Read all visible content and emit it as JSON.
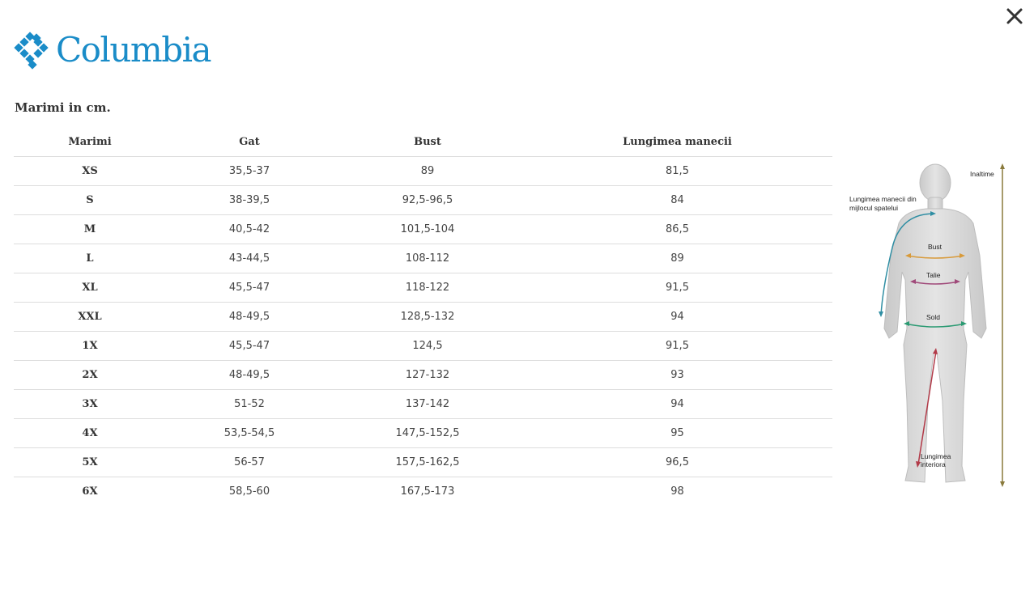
{
  "brand": {
    "name": "Columbia",
    "color": "#1a8cc8"
  },
  "close_icon": "close-icon",
  "title": "Marimi in cm.",
  "table": {
    "headers": [
      "Marimi",
      "Gat",
      "Bust",
      "Lungimea manecii"
    ],
    "rows": [
      [
        "XS",
        "35,5-37",
        "89",
        "81,5"
      ],
      [
        "S",
        "38-39,5",
        "92,5-96,5",
        "84"
      ],
      [
        "M",
        "40,5-42",
        "101,5-104",
        "86,5"
      ],
      [
        "L",
        "43-44,5",
        "108-112",
        "89"
      ],
      [
        "XL",
        "45,5-47",
        "118-122",
        "91,5"
      ],
      [
        "XXL",
        "48-49,5",
        "128,5-132",
        "94"
      ],
      [
        "1X",
        "45,5-47",
        "124,5",
        "91,5"
      ],
      [
        "2X",
        "48-49,5",
        "127-132",
        "93"
      ],
      [
        "3X",
        "51-52",
        "137-142",
        "94"
      ],
      [
        "4X",
        "53,5-54,5",
        "147,5-152,5",
        "95"
      ],
      [
        "5X",
        "56-57",
        "157,5-162,5",
        "96,5"
      ],
      [
        "6X",
        "58,5-60",
        "167,5-173",
        "98"
      ]
    ]
  },
  "figure": {
    "labels": {
      "height": "Inaltime",
      "sleeve_line1": "Lungimea manecii din",
      "sleeve_line2": "mijlocul spatelui",
      "bust": "Bust",
      "waist": "Talie",
      "hip": "Sold",
      "inseam_line1": "Lungimea",
      "inseam_line2": "interiora"
    }
  }
}
